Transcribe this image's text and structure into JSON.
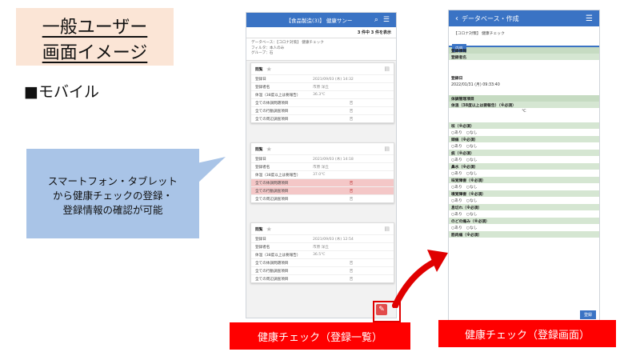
{
  "title": {
    "line1": "一般ユーザー",
    "line2": "画面イメージ"
  },
  "mobile_label": "■モバイル",
  "callout": {
    "line1": "スマートフォン・タブレット",
    "line2": "から健康チェックの登録・",
    "line3": "登録情報の確認が可能"
  },
  "list_screen": {
    "header_title": "【食品製造(3)】 健康サンー",
    "count": "3 件中 3 件を表示",
    "info": [
      "データベース：【コロナ対策】 健康チェック",
      "フィルタ：本人のみ",
      "グループ：石"
    ],
    "cards": [
      {
        "badge": "閲覧",
        "rows": [
          {
            "key": "登録日",
            "value": "2021/09/03 (木) 14:32"
          },
          {
            "key": "登録者名",
            "value": "市原 洋丘"
          },
          {
            "key": "体温（38度以上は要報告）",
            "value": "36.3℃"
          },
          {
            "key": "全ての体調問題項目",
            "value": "否"
          },
          {
            "key": "全ての行動調査項目",
            "value": "否"
          },
          {
            "key": "全ての周辺調査項目",
            "value": "否"
          }
        ]
      },
      {
        "badge": "閲覧",
        "rows": [
          {
            "key": "登録日",
            "value": "2021/09/03 (木) 14:18"
          },
          {
            "key": "登録者名",
            "value": "市原 洋丘"
          },
          {
            "key": "体温（38度以上は要報告）",
            "value": "37.0℃"
          },
          {
            "key": "全ての体調問題項目",
            "value": "否"
          },
          {
            "key": "全ての行動調査項目",
            "value": "否"
          },
          {
            "key": "全ての周辺調査項目",
            "value": "否"
          }
        ]
      },
      {
        "badge": "閲覧",
        "rows": [
          {
            "key": "登録日",
            "value": "2021/09/03 (木) 12:54"
          },
          {
            "key": "登録者名",
            "value": "市原 洋丘"
          },
          {
            "key": "体温（38度以上は要報告）",
            "value": "36.5℃"
          },
          {
            "key": "全ての体調問題項目",
            "value": "否"
          },
          {
            "key": "全ての行動調査項目",
            "value": "否"
          },
          {
            "key": "全ての周辺調査項目",
            "value": "否"
          }
        ]
      }
    ]
  },
  "form_screen": {
    "header_back": "‹",
    "header_title": "データベース・作成",
    "subtitle": "【コロナ対策】 健康チェック",
    "tab": "内容",
    "sections": {
      "reg_info": "登録情報",
      "reg_name": "登録者名",
      "reg_date": "登録日",
      "reg_date_value": "2022/01/31 (月) 09:33:40",
      "condition": "体調管理項目",
      "temp": "体温（38度以上は要報告）（※必須）",
      "temp_unit": "℃",
      "cough": "咳（※必須）",
      "headache": "頭痛（※必須）",
      "phlegm": "痰（※必須）",
      "runny_nose": "鼻水（※必須）",
      "taste": "味覚障害（※必須）",
      "smell": "嗅覚障害（※必須）",
      "breath": "息切れ（※必須）",
      "throat": "のどの痛み（※必須）",
      "muscle": "筋肉痛（※必須）"
    },
    "radio_yes": "○あり",
    "radio_no": "○なし",
    "submit": "登録"
  },
  "labels": {
    "list": "健康チェック（登録一覧）",
    "form": "健康チェック（登録画面）"
  },
  "colors": {
    "header_blue": "#3a73c4",
    "label_red": "#ff0000",
    "callout_blue": "#a9c4e7",
    "title_bg": "#fbe5d6",
    "section_green": "#d5e6d2"
  }
}
